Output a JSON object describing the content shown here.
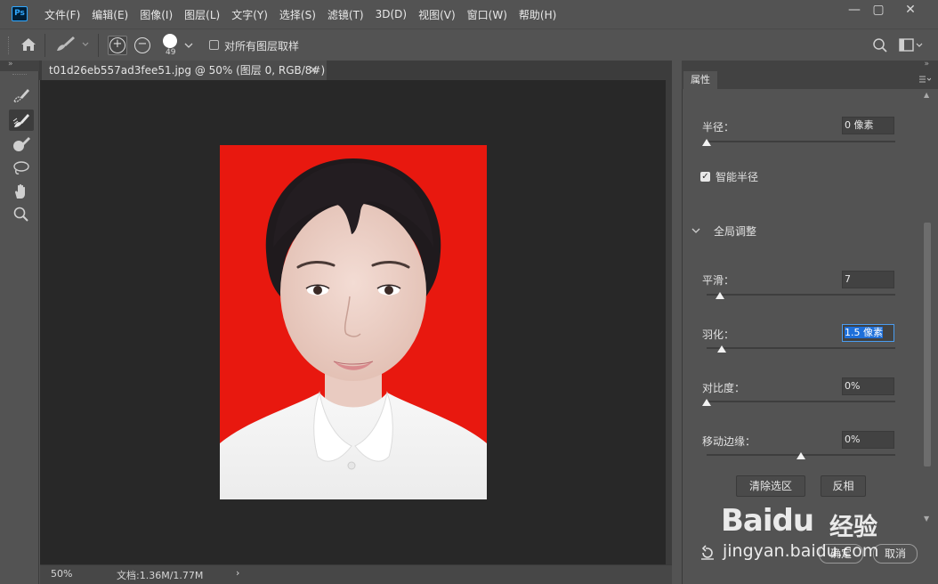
{
  "app": {
    "logo_text": "Ps"
  },
  "menu": [
    "文件(F)",
    "编辑(E)",
    "图像(I)",
    "图层(L)",
    "文字(Y)",
    "选择(S)",
    "滤镜(T)",
    "3D(D)",
    "视图(V)",
    "窗口(W)",
    "帮助(H)"
  ],
  "window_controls": {
    "minimize": "—",
    "maximize": "▢",
    "close": "✕"
  },
  "options_bar": {
    "brush_size": "49",
    "sample_all_layers_label": "对所有图层取样",
    "sample_all_layers_checked": false
  },
  "document": {
    "tab_title": "t01d26eb557ad3fee51.jpg @ 50% (图层 0, RGB/8#) *",
    "tab_close": "×",
    "background_color": "#e8180f"
  },
  "status_bar": {
    "zoom": "50%",
    "doc_info": "文档:1.36M/1.77M",
    "arrow": "›"
  },
  "properties_panel": {
    "tab_label": "属性",
    "radius_label": "半径：",
    "radius_value": "0 像素",
    "radius_level": 0,
    "smart_radius_label": "智能半径",
    "smart_radius_checked": true,
    "global_section_label": "全局调整",
    "smooth_label": "平滑：",
    "smooth_value": "7",
    "feather_label": "羽化：",
    "feather_value": "1.5 像素",
    "contrast_label": "对比度：",
    "contrast_value": "0%",
    "shift_edge_label": "移动边缘：",
    "shift_edge_value": "0%",
    "clear_selection_button": "清除选区",
    "invert_button": "反相",
    "ok_button": "确定",
    "cancel_button": "取消"
  },
  "watermark": {
    "brand": "Baidu",
    "product": "经验",
    "url": "jingyan.baidu.com"
  },
  "colors": {
    "accent_selection": "#1e6fd9",
    "ui_background": "#535353",
    "canvas_background": "#282828"
  }
}
